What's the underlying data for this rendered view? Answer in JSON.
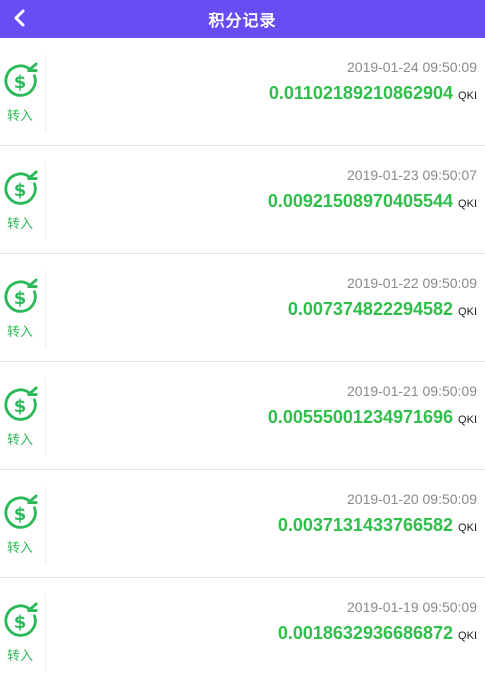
{
  "header": {
    "title": "积分记录",
    "back_icon": "chevron-left-icon"
  },
  "colors": {
    "header_bg": "#6a4cf5",
    "amount": "#2fbf4a",
    "icon": "#2cb95a",
    "date": "#8a8a8a"
  },
  "records": [
    {
      "type": "转入",
      "time": "2019-01-24 09:50:09",
      "amount": "0.01102189210862904",
      "unit": "QKI"
    },
    {
      "type": "转入",
      "time": "2019-01-23 09:50:07",
      "amount": "0.00921508970405544",
      "unit": "QKI"
    },
    {
      "type": "转入",
      "time": "2019-01-22 09:50:09",
      "amount": "0.007374822294582",
      "unit": "QKI"
    },
    {
      "type": "转入",
      "time": "2019-01-21 09:50:09",
      "amount": "0.00555001234971696",
      "unit": "QKI"
    },
    {
      "type": "转入",
      "time": "2019-01-20 09:50:09",
      "amount": "0.0037131433766582",
      "unit": "QKI"
    },
    {
      "type": "转入",
      "time": "2019-01-19 09:50:09",
      "amount": "0.0018632936686872",
      "unit": "QKI"
    }
  ],
  "record_icon": "dollar-transfer-in-icon"
}
